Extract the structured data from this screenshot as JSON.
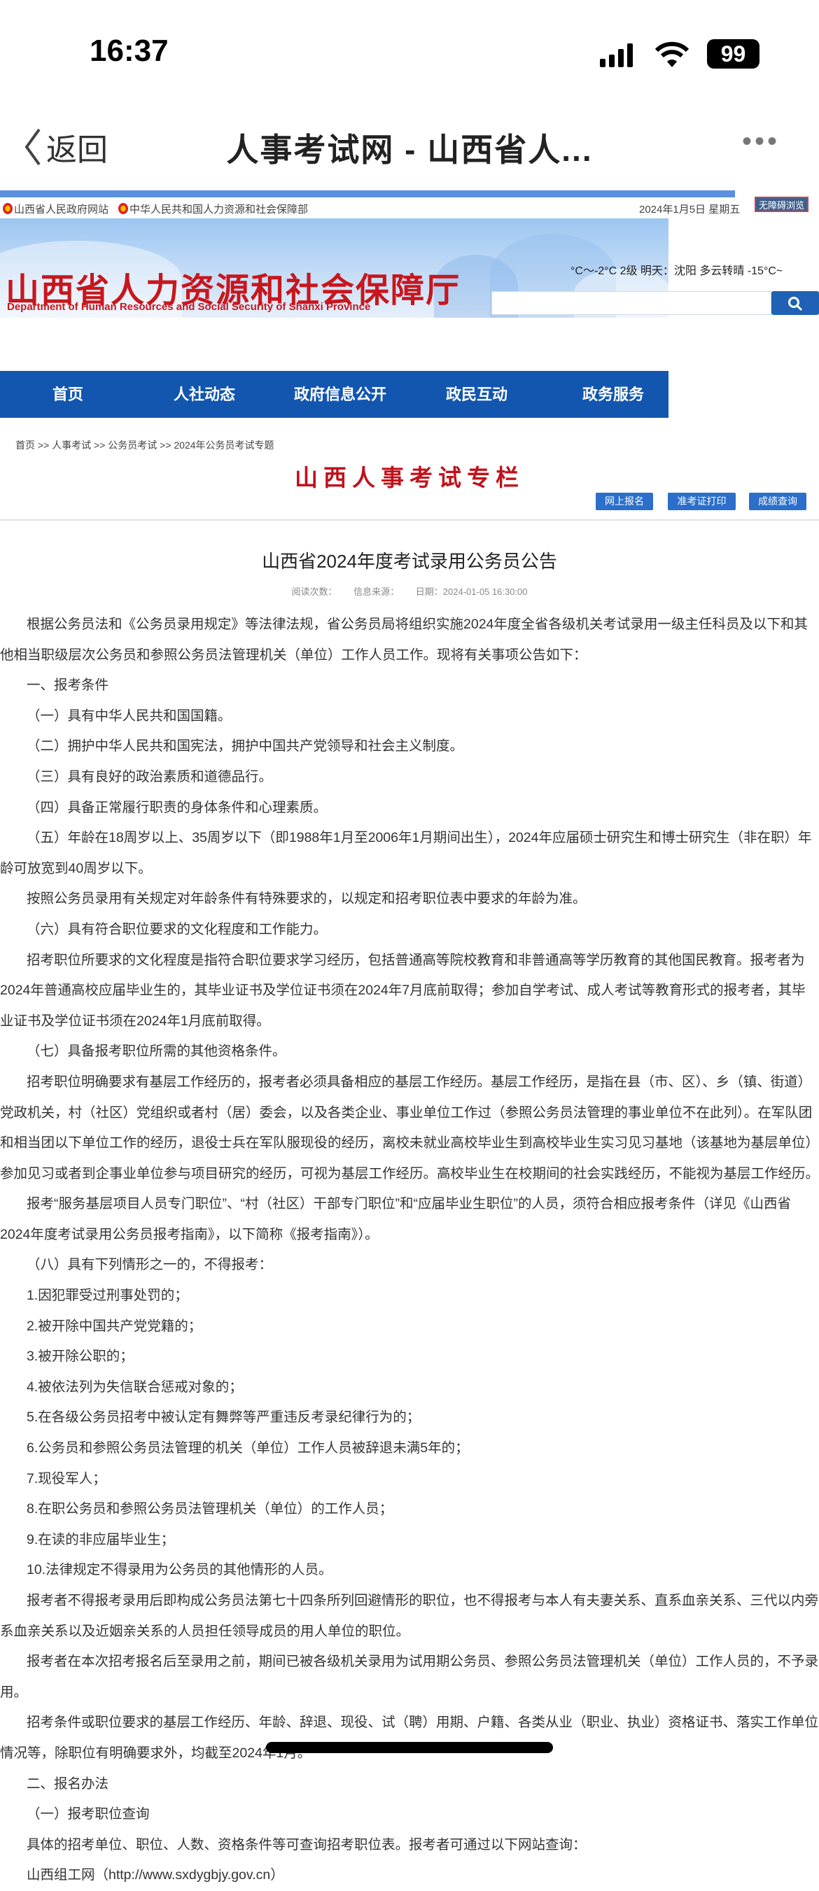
{
  "status": {
    "time": "16:37",
    "battery": "99"
  },
  "navbar": {
    "back": "返回",
    "title": "人事考试网 - 山西省人...",
    "more": "•••"
  },
  "gov_links": [
    "山西省人民政府网站",
    "中华人民共和国人力资源和社会保障部"
  ],
  "date": "2024年1月5日 星期五",
  "accessibility": "无障碍浏览",
  "brand": {
    "cn": "山西省人力资源和社会保障厅",
    "en": "Department of Human Resources and Social Security of Shanxi Province"
  },
  "weather": "°C～-2°C 2级 明天：沈阳 多云转晴 -15°C~",
  "search": {
    "placeholder": ""
  },
  "nav": [
    "首页",
    "人社动态",
    "政府信息公开",
    "政民互动",
    "政务服务"
  ],
  "breadcrumb": "首页 >> 人事考试 >> 公务员考试 >> 2024年公务员考试专题",
  "column_title": "山西人事考试专栏",
  "quick_buttons": [
    "网上报名",
    "准考证打印",
    "成绩查询"
  ],
  "article": {
    "title": "山西省2024年度考试录用公务员公告",
    "meta": {
      "reads": "阅读次数：",
      "source": "信息来源：",
      "date": "日期：2024-01-05 16:30:00"
    },
    "paragraphs": [
      "根据公务员法和《公务员录用规定》等法律法规，省公务员局将组织实施2024年度全省各级机关考试录用一级主任科员及以下和其他相当职级层次公务员和参照公务员法管理机关（单位）工作人员工作。现将有关事项公告如下：",
      "一、报考条件",
      "（一）具有中华人民共和国国籍。",
      "（二）拥护中华人民共和国宪法，拥护中国共产党领导和社会主义制度。",
      "（三）具有良好的政治素质和道德品行。",
      "（四）具备正常履行职责的身体条件和心理素质。",
      "（五）年龄在18周岁以上、35周岁以下（即1988年1月至2006年1月期间出生），2024年应届硕士研究生和博士研究生（非在职）年龄可放宽到40周岁以下。",
      "按照公务员录用有关规定对年龄条件有特殊要求的，以规定和招考职位表中要求的年龄为准。",
      "（六）具有符合职位要求的文化程度和工作能力。",
      "招考职位所要求的文化程度是指符合职位要求学习经历，包括普通高等院校教育和非普通高等学历教育的其他国民教育。报考者为2024年普通高校应届毕业生的，其毕业证书及学位证书须在2024年7月底前取得；参加自学考试、成人考试等教育形式的报考者，其毕业证书及学位证书须在2024年1月底前取得。",
      "（七）具备报考职位所需的其他资格条件。",
      "招考职位明确要求有基层工作经历的，报考者必须具备相应的基层工作经历。基层工作经历，是指在县（市、区）、乡（镇、街道）党政机关，村（社区）党组织或者村（居）委会，以及各类企业、事业单位工作过（参照公务员法管理的事业单位不在此列）。在军队团和相当团以下单位工作的经历，退役士兵在军队服现役的经历，离校未就业高校毕业生到高校毕业生实习见习基地（该基地为基层单位）参加见习或者到企事业单位参与项目研究的经历，可视为基层工作经历。高校毕业生在校期间的社会实践经历，不能视为基层工作经历。",
      "报考“服务基层项目人员专门职位”、“村（社区）干部专门职位”和“应届毕业生职位”的人员，须符合相应报考条件（详见《山西省2024年度考试录用公务员报考指南》，以下简称《报考指南》）。",
      "（八）具有下列情形之一的，不得报考：",
      "1.因犯罪受过刑事处罚的；",
      "2.被开除中国共产党党籍的；",
      "3.被开除公职的；",
      "4.被依法列为失信联合惩戒对象的；",
      "5.在各级公务员招考中被认定有舞弊等严重违反考录纪律行为的；",
      "6.公务员和参照公务员法管理的机关（单位）工作人员被辞退未满5年的；",
      "7.现役军人；",
      "8.在职公务员和参照公务员法管理机关（单位）的工作人员；",
      "9.在读的非应届毕业生；",
      "10.法律规定不得录用为公务员的其他情形的人员。",
      "报考者不得报考录用后即构成公务员法第七十四条所列回避情形的职位，也不得报考与本人有夫妻关系、直系血亲关系、三代以内旁系血亲关系以及近姻亲关系的人员担任领导成员的用人单位的职位。",
      "报考者在本次招考报名后至录用之前，期间已被各级机关录用为试用期公务员、参照公务员法管理机关（单位）工作人员的，不予录用。",
      "招考条件或职位要求的基层工作经历、年龄、辞退、现役、试（聘）用期、户籍、各类从业（职业、执业）资格证书、落实工作单位情况等，除职位有明确要求外，均截至2024年1月。",
      "二、报名办法",
      "（一）报考职位查询",
      "具体的招考单位、职位、人数、资格条件等可查询招考职位表。报考者可通过以下网站查询：",
      "山西组工网（http://www.sxdygbjy.gov.cn）"
    ]
  }
}
